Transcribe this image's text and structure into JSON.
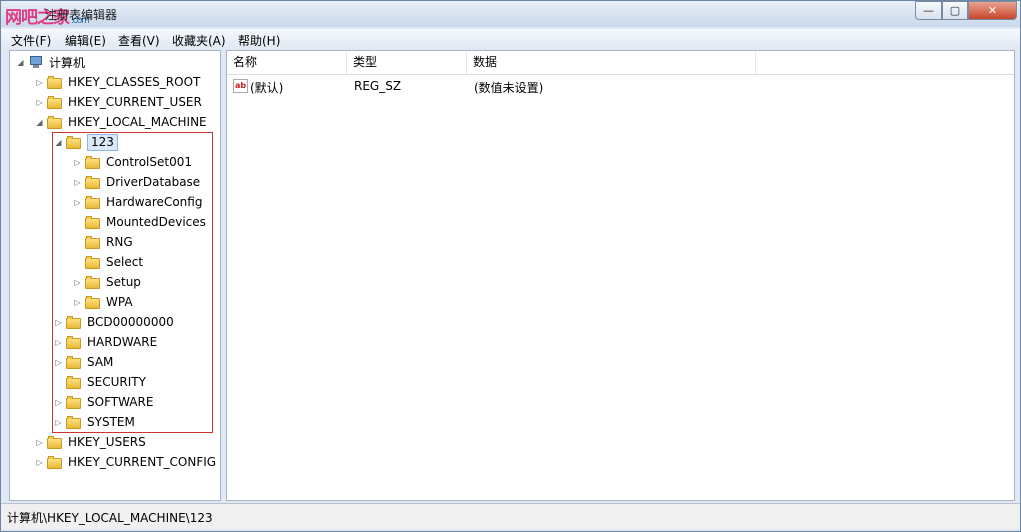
{
  "window": {
    "title": "注册表编辑器",
    "watermark": "网吧之家",
    "watermark_sub": ".com",
    "controls": {
      "minimize": "—",
      "maximize": "▢",
      "close": "✕"
    }
  },
  "menu": [
    "文件(F)",
    "编辑(E)",
    "查看(V)",
    "收藏夹(A)",
    "帮助(H)"
  ],
  "tree": {
    "root": "计算机",
    "items": [
      "HKEY_CLASSES_ROOT",
      "HKEY_CURRENT_USER",
      "HKEY_LOCAL_MACHINE",
      "123",
      "ControlSet001",
      "DriverDatabase",
      "HardwareConfig",
      "MountedDevices",
      "RNG",
      "Select",
      "Setup",
      "WPA",
      "BCD00000000",
      "HARDWARE",
      "SAM",
      "SECURITY",
      "SOFTWARE",
      "SYSTEM",
      "HKEY_USERS",
      "HKEY_CURRENT_CONFIG"
    ]
  },
  "list": {
    "columns": [
      "名称",
      "类型",
      "数据"
    ],
    "rows": [
      {
        "name": "(默认)",
        "type": "REG_SZ",
        "data": "(数值未设置)",
        "icon": "string-value-icon"
      }
    ]
  },
  "status": "计算机\\HKEY_LOCAL_MACHINE\\123"
}
